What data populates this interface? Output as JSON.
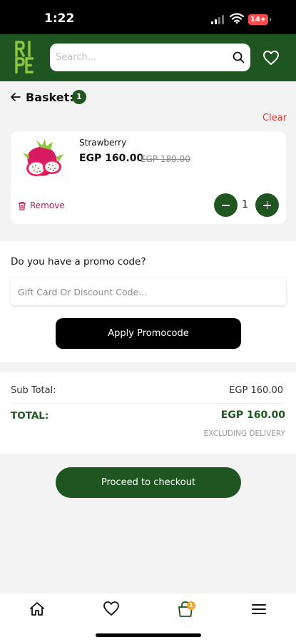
{
  "status_bar": {
    "time": "1:22",
    "battery": "14+"
  },
  "header": {
    "logo_text": "RIPE",
    "search_placeholder": "Search..."
  },
  "basket": {
    "back_icon": "arrow-left-icon",
    "title": "Basket:",
    "count": "1",
    "clear_label": "Clear",
    "items": [
      {
        "name": "Strawberry",
        "price": "EGP 160.00",
        "old_price": "EGP 180.00",
        "remove_label": "Remove",
        "quantity": "1",
        "image_icon": "dragon-fruit-icon"
      }
    ]
  },
  "promo": {
    "question": "Do you have a promo code?",
    "input_placeholder": "Gift Card Or Discount Code...",
    "apply_label": "Apply Promocode"
  },
  "totals": {
    "subtotal_label": "Sub Total:",
    "subtotal_value": "EGP 160.00",
    "total_label": "TOTAL:",
    "total_value": "EGP 160.00",
    "delivery_note": "EXCLUDING DELIVERY"
  },
  "checkout_label": "Proceed to checkout",
  "bottom_nav": {
    "items": [
      "home-icon",
      "heart-icon",
      "cart-icon",
      "menu-icon"
    ],
    "cart_badge": "1"
  },
  "colors": {
    "brand_green": "#1e5520",
    "logo_lime": "#8dc63f",
    "clear_red": "#e53935",
    "remove_pink": "#c2185b",
    "badge_orange": "#f5a623"
  }
}
